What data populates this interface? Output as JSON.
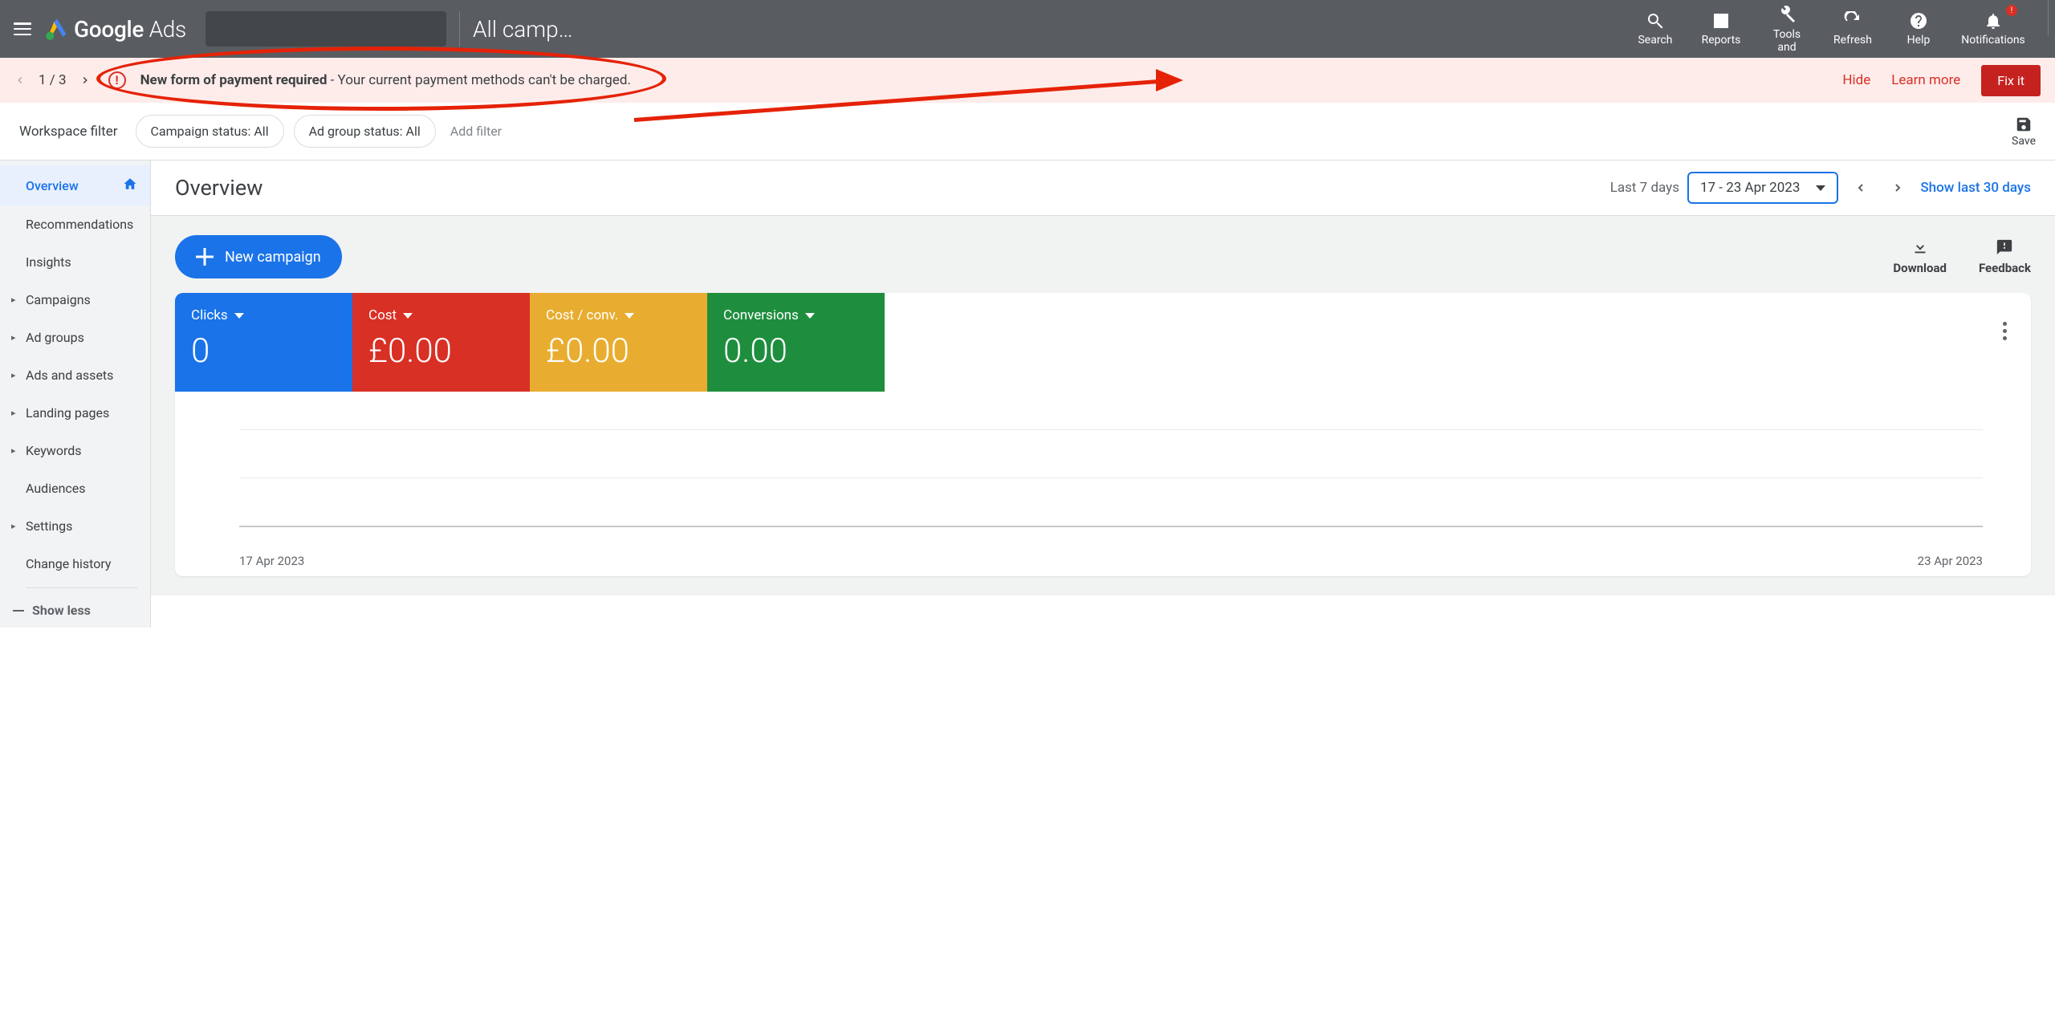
{
  "header": {
    "product": "Google",
    "sub_product": "Ads",
    "context_dropdown": "All camp…",
    "actions": [
      {
        "name": "search",
        "label": "Search"
      },
      {
        "name": "reports",
        "label": "Reports"
      },
      {
        "name": "tools",
        "label": "Tools",
        "sub_label": "and"
      },
      {
        "name": "refresh",
        "label": "Refresh"
      },
      {
        "name": "help",
        "label": "Help"
      },
      {
        "name": "notifications",
        "label": "Notifications",
        "badge": "!"
      }
    ]
  },
  "alert": {
    "counter": "1 / 3",
    "title": "New form of payment required",
    "body": " - Your current payment methods can't be charged.",
    "hide": "Hide",
    "learn_more": "Learn more",
    "fix_it": "Fix it"
  },
  "filter_bar": {
    "label": "Workspace filter",
    "chips": [
      "Campaign status: All",
      "Ad group status: All"
    ],
    "add_filter": "Add filter",
    "save": "Save"
  },
  "sidebar": {
    "items": [
      {
        "label": "Overview",
        "active": true,
        "icon": "home"
      },
      {
        "label": "Recommendations"
      },
      {
        "label": "Insights"
      },
      {
        "label": "Campaigns",
        "caret": true
      },
      {
        "label": "Ad groups",
        "caret": true
      },
      {
        "label": "Ads and assets",
        "caret": true
      },
      {
        "label": "Landing pages",
        "caret": true
      },
      {
        "label": "Keywords",
        "caret": true
      },
      {
        "label": "Audiences"
      },
      {
        "label": "Settings",
        "caret": true
      },
      {
        "label": "Change history"
      }
    ],
    "show_less": "Show less"
  },
  "page": {
    "title": "Overview",
    "last_days": "Last 7 days",
    "date_range": "17 - 23 Apr 2023",
    "show30": "Show last 30 days"
  },
  "toolbar": {
    "new_campaign": "New campaign",
    "download": "Download",
    "feedback": "Feedback"
  },
  "chart_data": {
    "type": "line",
    "title": "",
    "metrics": [
      {
        "name": "Clicks",
        "value": "0",
        "color": "#1a73e8"
      },
      {
        "name": "Cost",
        "value": "£0.00",
        "color": "#d93025"
      },
      {
        "name": "Cost / conv.",
        "value": "£0.00",
        "color": "#e8ad30"
      },
      {
        "name": "Conversions",
        "value": "0.00",
        "color": "#1e8e3e"
      }
    ],
    "x_start": "17 Apr 2023",
    "x_end": "23 Apr 2023",
    "series": [
      {
        "name": "Clicks",
        "values": [
          0,
          0,
          0,
          0,
          0,
          0,
          0
        ]
      },
      {
        "name": "Cost",
        "values": [
          0,
          0,
          0,
          0,
          0,
          0,
          0
        ]
      },
      {
        "name": "Cost / conv.",
        "values": [
          0,
          0,
          0,
          0,
          0,
          0,
          0
        ]
      },
      {
        "name": "Conversions",
        "values": [
          0,
          0,
          0,
          0,
          0,
          0,
          0
        ]
      }
    ],
    "ylim": [
      0,
      1
    ]
  }
}
